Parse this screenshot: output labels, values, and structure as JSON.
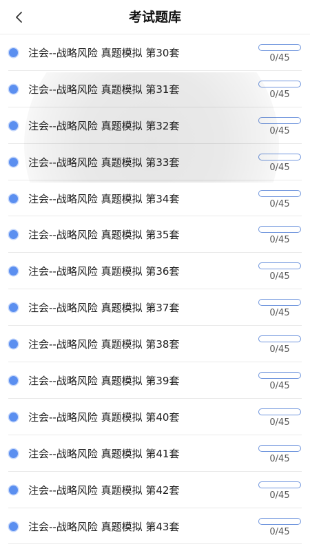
{
  "header": {
    "title": "考试题库",
    "back_icon": "chevron-left-icon"
  },
  "colors": {
    "accent": "#5b8ff0",
    "progress_border": "#6f95dd",
    "divider": "#e9e9e9"
  },
  "list": {
    "items": [
      {
        "title": "注会--战略风险 真题模拟 第30套",
        "progress_text": "0/45",
        "progress": 0
      },
      {
        "title": "注会--战略风险 真题模拟 第31套",
        "progress_text": "0/45",
        "progress": 0
      },
      {
        "title": "注会--战略风险 真题模拟 第32套",
        "progress_text": "0/45",
        "progress": 0
      },
      {
        "title": "注会--战略风险 真题模拟 第33套",
        "progress_text": "0/45",
        "progress": 0
      },
      {
        "title": "注会--战略风险 真题模拟 第34套",
        "progress_text": "0/45",
        "progress": 0
      },
      {
        "title": "注会--战略风险 真题模拟 第35套",
        "progress_text": "0/45",
        "progress": 0
      },
      {
        "title": "注会--战略风险 真题模拟 第36套",
        "progress_text": "0/45",
        "progress": 0
      },
      {
        "title": "注会--战略风险 真题模拟 第37套",
        "progress_text": "0/45",
        "progress": 0
      },
      {
        "title": "注会--战略风险 真题模拟 第38套",
        "progress_text": "0/45",
        "progress": 0
      },
      {
        "title": "注会--战略风险 真题模拟 第39套",
        "progress_text": "0/45",
        "progress": 0
      },
      {
        "title": "注会--战略风险 真题模拟 第40套",
        "progress_text": "0/45",
        "progress": 0
      },
      {
        "title": "注会--战略风险 真题模拟 第41套",
        "progress_text": "0/45",
        "progress": 0
      },
      {
        "title": "注会--战略风险 真题模拟 第42套",
        "progress_text": "0/45",
        "progress": 0
      },
      {
        "title": "注会--战略风险 真题模拟 第43套",
        "progress_text": "0/45",
        "progress": 0
      }
    ]
  }
}
